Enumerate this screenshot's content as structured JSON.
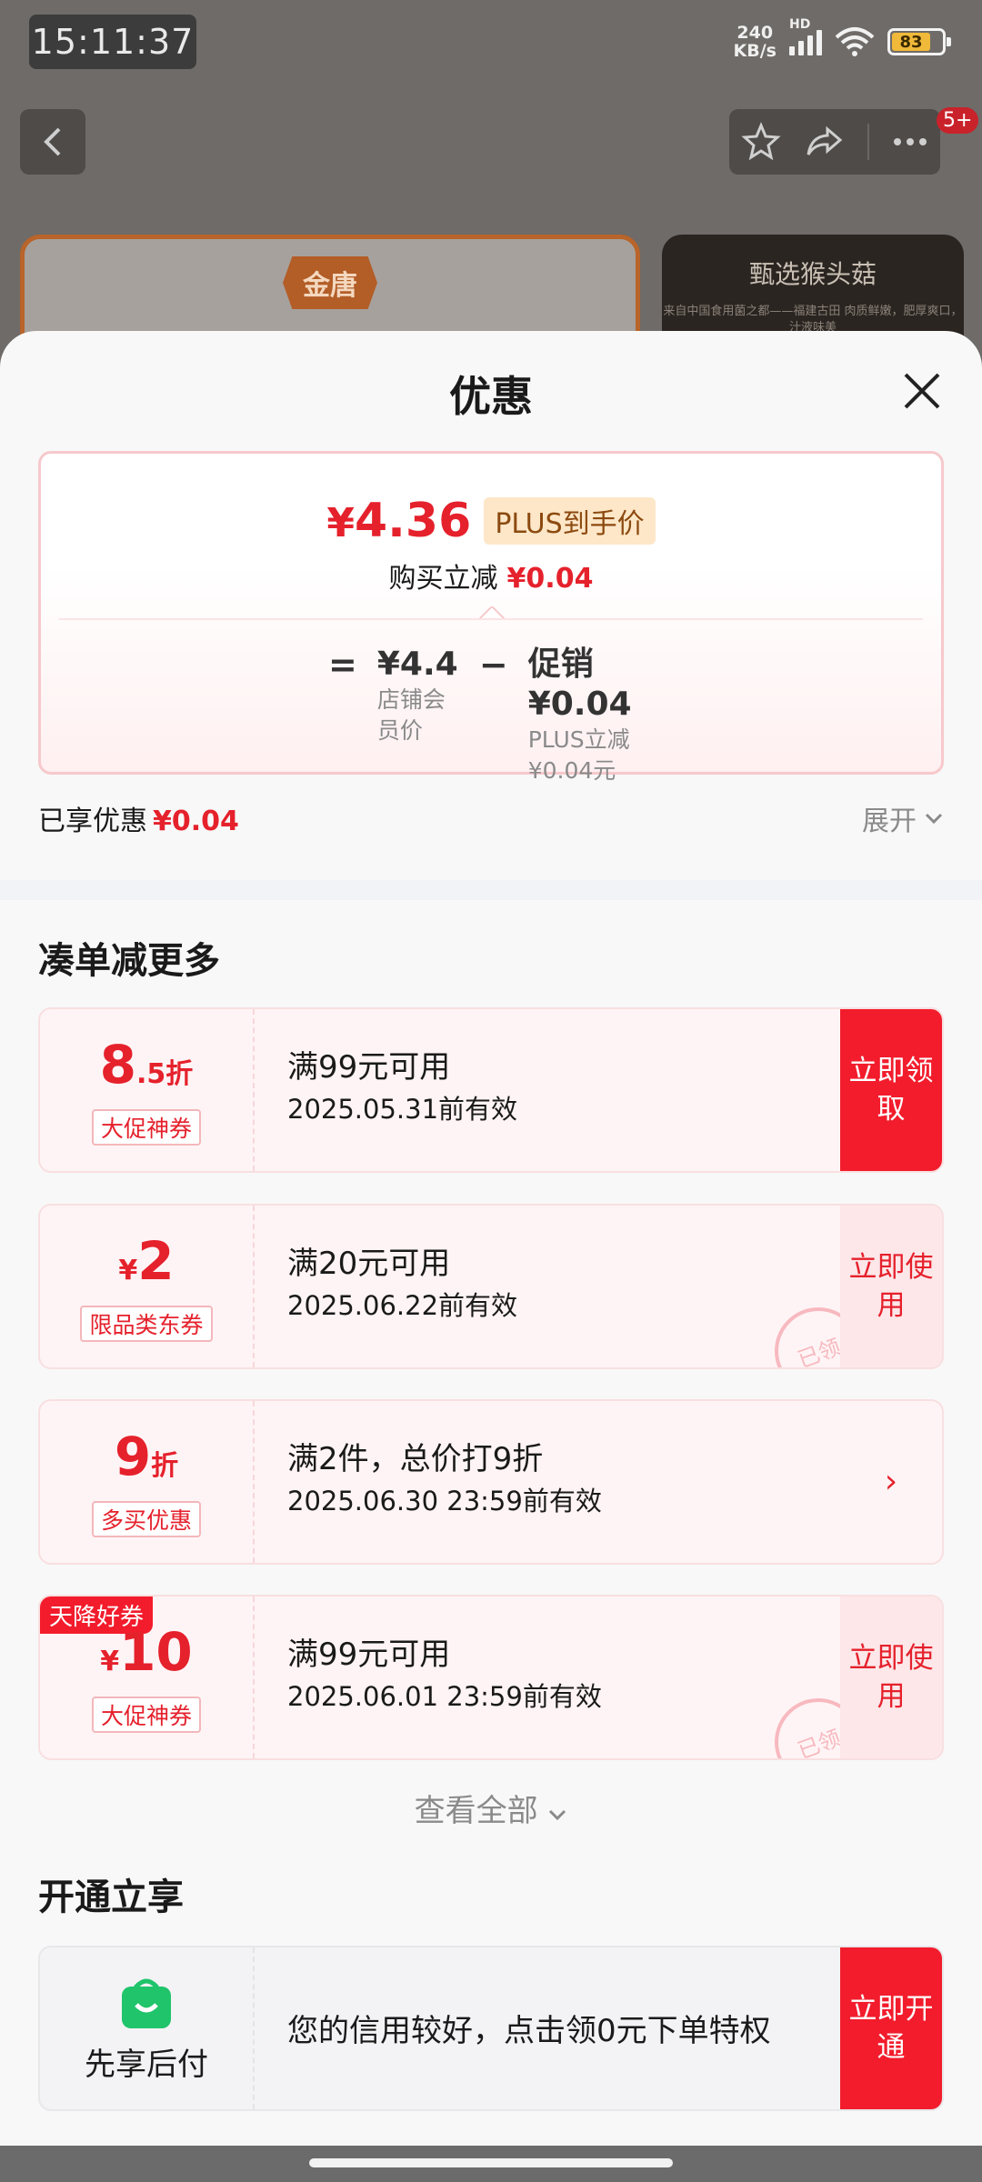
{
  "status_bar": {
    "time": "15:11:37",
    "network_speed_value": "240",
    "network_speed_unit": "KB/s",
    "network_type": "HD",
    "battery": "83"
  },
  "background": {
    "brand_logo": "金唐",
    "side_card_title": "甄选猴头菇",
    "side_card_subtitle": "来自中国食用菌之都——福建古田 肉质鲜嫩，肥厚爽口，汁液味美",
    "notification_badge": "5+"
  },
  "sheet": {
    "title": "优惠",
    "price": {
      "currency": "¥",
      "amount": "4.36",
      "plus_label": "PLUS到手价",
      "reduce_label": "购买立减",
      "reduce_amount": "¥0.04"
    },
    "formula": {
      "equals": "=",
      "base_value": "¥4.4",
      "base_label": "店铺会员价",
      "minus": "−",
      "promo_value": "促销 ¥0.04",
      "promo_label": "PLUS立减¥0.04元"
    },
    "enjoyed_label": "已享优惠",
    "enjoyed_amount": "¥0.04",
    "expand_label": "展开"
  },
  "section_more": {
    "title": "凑单减更多",
    "coupons": [
      {
        "amount_main": "8",
        "amount_suffix": ".5折",
        "tag": "大促神券",
        "condition": "满99元可用",
        "validity": "2025.05.31前有效",
        "action": "立即领取"
      },
      {
        "amount_prefix": "¥",
        "amount_main": "2",
        "tag": "限品类东券",
        "condition": "满20元可用",
        "validity": "2025.06.22前有效",
        "action": "立即使用",
        "stamp": "已领"
      },
      {
        "amount_main": "9",
        "amount_suffix": "折",
        "tag": "多买优惠",
        "condition": "满2件，总价打9折",
        "validity": "2025.06.30 23:59前有效",
        "action": "›"
      },
      {
        "corner": "天降好券",
        "amount_prefix": "¥",
        "amount_main": "10",
        "tag": "大促神券",
        "condition": "满99元可用",
        "validity": "2025.06.01 23:59前有效",
        "action": "立即使用",
        "stamp": "已领"
      }
    ],
    "view_all": "查看全部"
  },
  "section_open": {
    "title": "开通立享",
    "card": {
      "label": "先享后付",
      "text": "您的信用较好，点击领0元下单特权",
      "action": "立即开通"
    }
  },
  "colors": {
    "accent_red": "#e5212c",
    "button_red": "#f21c2c",
    "plus_tag_bg": "#fde7c8"
  }
}
